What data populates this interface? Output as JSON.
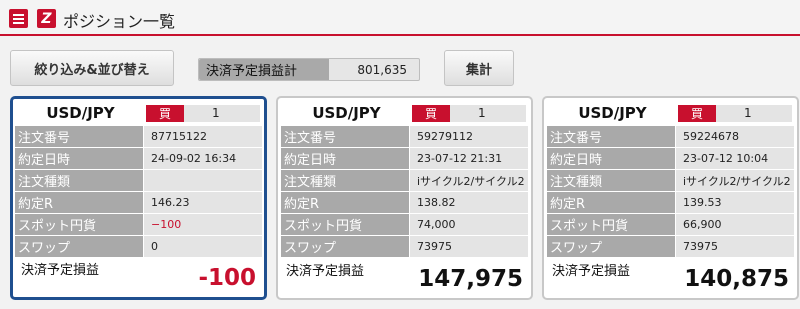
{
  "header": {
    "menu_icon": "hamburger-menu-icon",
    "logo_letter": "Z",
    "title": "ポジション一覧",
    "accent_color": "#c8102e"
  },
  "toolbar": {
    "filter_label": "絞り込み&並び替え",
    "pl_label": "決済予定損益計",
    "pl_value": "801,635",
    "summary_label": "集計"
  },
  "row_labels": {
    "order_no": "注文番号",
    "contract_time": "約定日時",
    "order_type": "注文種類",
    "contract_rate": "約定R",
    "spot_yen": "スポット円貨",
    "swap": "スワップ",
    "pl": "決済予定損益"
  },
  "cards": [
    {
      "pair": "USD/JPY",
      "side": "買",
      "quantity": "1",
      "order_no": "87715122",
      "contract_time": "24-09-02 16:34",
      "order_type": "",
      "contract_rate": "146.23",
      "spot_yen": "−100",
      "swap": "0",
      "pl": "-100",
      "selected": true
    },
    {
      "pair": "USD/JPY",
      "side": "買",
      "quantity": "1",
      "order_no": "59279112",
      "contract_time": "23-07-12 21:31",
      "order_type": "iサイクル2/サイクル2",
      "contract_rate": "138.82",
      "spot_yen": "74,000",
      "swap": "73975",
      "pl": "147,975",
      "selected": false
    },
    {
      "pair": "USD/JPY",
      "side": "買",
      "quantity": "1",
      "order_no": "59224678",
      "contract_time": "23-07-12 10:04",
      "order_type": "iサイクル2/サイクル2",
      "contract_rate": "139.53",
      "spot_yen": "66,900",
      "swap": "73975",
      "pl": "140,875",
      "selected": false
    }
  ]
}
